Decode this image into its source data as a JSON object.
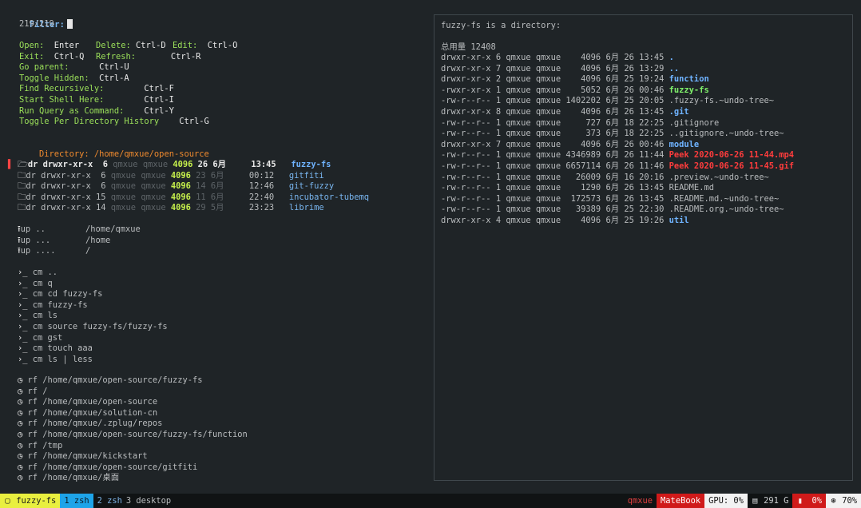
{
  "filter": {
    "label": "Filter:",
    "count": "219/219"
  },
  "help": [
    [
      {
        "k": "Open:",
        "v": "  Enter"
      },
      {
        "k": "Delete:",
        "v": " Ctrl-D"
      },
      {
        "k": "Edit:",
        "v": "  Ctrl-O"
      }
    ],
    [
      {
        "k": "Exit:",
        "v": "  Ctrl-Q"
      },
      {
        "k": "Refresh:",
        "v": "       Ctrl-R"
      }
    ],
    [
      {
        "k": "Go parent:",
        "v": "      Ctrl-U"
      }
    ],
    [
      {
        "k": "Toggle Hidden:",
        "v": "  Ctrl-A"
      }
    ],
    [
      {
        "k": "Find Recursively:",
        "v": "        Ctrl-F"
      }
    ],
    [
      {
        "k": "Start Shell Here:",
        "v": "        Ctrl-I"
      }
    ],
    [
      {
        "k": "Run Query as Command:",
        "v": "    Ctrl-Y"
      }
    ],
    [
      {
        "k": "Toggle Per Directory History",
        "v": "    Ctrl-G"
      }
    ]
  ],
  "directory": {
    "label": "Directory:",
    "path": "/home/qmxue/open-source"
  },
  "entries": [
    {
      "mode": "dr drwxr-xr-x",
      "links": "6",
      "user": "qmxue",
      "group": "qmxue",
      "size": "4096",
      "date": "26 6月",
      "time": "13:45",
      "name": "fuzzy-fs",
      "selected": true
    },
    {
      "mode": "dr drwxr-xr-x",
      "links": "6",
      "user": "qmxue",
      "group": "qmxue",
      "size": "4096",
      "date": "23 6月",
      "time": "00:12",
      "name": "gitfiti",
      "selected": false
    },
    {
      "mode": "dr drwxr-xr-x",
      "links": "6",
      "user": "qmxue",
      "group": "qmxue",
      "size": "4096",
      "date": "14 6月",
      "time": "12:46",
      "name": "git-fuzzy",
      "selected": false
    },
    {
      "mode": "dr drwxr-xr-x",
      "links": "15",
      "user": "qmxue",
      "group": "qmxue",
      "size": "4096",
      "date": "11 6月",
      "time": "22:40",
      "name": "incubator-tubemq",
      "selected": false
    },
    {
      "mode": "dr drwxr-xr-x",
      "links": "14",
      "user": "qmxue",
      "group": "qmxue",
      "size": "4096",
      "date": "29 5月",
      "time": "23:23",
      "name": "librime",
      "selected": false
    }
  ],
  "ups": [
    {
      "cmd": "up",
      "arg": "..",
      "path": "/home/qmxue"
    },
    {
      "cmd": "up",
      "arg": "...",
      "path": "/home"
    },
    {
      "cmd": "up",
      "arg": "....",
      "path": "/"
    }
  ],
  "cmds": [
    {
      "cmd": "cm",
      "arg": ".."
    },
    {
      "cmd": "cm",
      "arg": "q"
    },
    {
      "cmd": "cm",
      "arg": "cd fuzzy-fs"
    },
    {
      "cmd": "cm",
      "arg": "fuzzy-fs"
    },
    {
      "cmd": "cm",
      "arg": "ls"
    },
    {
      "cmd": "cm",
      "arg": "source fuzzy-fs/fuzzy-fs"
    },
    {
      "cmd": "cm",
      "arg": "gst"
    },
    {
      "cmd": "cm",
      "arg": "touch aaa"
    },
    {
      "cmd": "cm",
      "arg": "ls | less"
    }
  ],
  "recents": [
    {
      "cmd": "rf",
      "arg": "/home/qmxue/open-source/fuzzy-fs"
    },
    {
      "cmd": "rf",
      "arg": "/"
    },
    {
      "cmd": "rf",
      "arg": "/home/qmxue/open-source"
    },
    {
      "cmd": "rf",
      "arg": "/home/qmxue/solution-cn"
    },
    {
      "cmd": "rf",
      "arg": "/home/qmxue/.zplug/repos"
    },
    {
      "cmd": "rf",
      "arg": "/home/qmxue/open-source/fuzzy-fs/function"
    },
    {
      "cmd": "rf",
      "arg": "/tmp"
    },
    {
      "cmd": "rf",
      "arg": "/home/qmxue/kickstart"
    },
    {
      "cmd": "rf",
      "arg": "/home/qmxue/open-source/gitfiti"
    },
    {
      "cmd": "rf",
      "arg": "/home/qmxue/桌面"
    }
  ],
  "preview": {
    "header": "fuzzy-fs is a directory:",
    "total": "总用量 12408",
    "rows": [
      {
        "perm": "drwxr-xr-x",
        "n": "6",
        "u": "qmxue",
        "g": "qmxue",
        "size": "4096",
        "m": "6月",
        "d": "26",
        "t": "13:45",
        "name": ".",
        "style": "blue"
      },
      {
        "perm": "drwxr-xr-x",
        "n": "7",
        "u": "qmxue",
        "g": "qmxue",
        "size": "4096",
        "m": "6月",
        "d": "26",
        "t": "13:29",
        "name": "..",
        "style": "blue"
      },
      {
        "perm": "drwxr-xr-x",
        "n": "2",
        "u": "qmxue",
        "g": "qmxue",
        "size": "4096",
        "m": "6月",
        "d": "25",
        "t": "19:24",
        "name": "function",
        "style": "blue"
      },
      {
        "perm": "-rwxr-xr-x",
        "n": "1",
        "u": "qmxue",
        "g": "qmxue",
        "size": "5052",
        "m": "6月",
        "d": "26",
        "t": "00:46",
        "name": "fuzzy-fs",
        "style": "green"
      },
      {
        "perm": "-rw-r--r--",
        "n": "1",
        "u": "qmxue",
        "g": "qmxue",
        "size": "1402202",
        "m": "6月",
        "d": "25",
        "t": "20:05",
        "name": ".fuzzy-fs.~undo-tree~",
        "style": "plain"
      },
      {
        "perm": "drwxr-xr-x",
        "n": "8",
        "u": "qmxue",
        "g": "qmxue",
        "size": "4096",
        "m": "6月",
        "d": "26",
        "t": "13:45",
        "name": ".git",
        "style": "blue"
      },
      {
        "perm": "-rw-r--r--",
        "n": "1",
        "u": "qmxue",
        "g": "qmxue",
        "size": "727",
        "m": "6月",
        "d": "18",
        "t": "22:25",
        "name": ".gitignore",
        "style": "plain"
      },
      {
        "perm": "-rw-r--r--",
        "n": "1",
        "u": "qmxue",
        "g": "qmxue",
        "size": "373",
        "m": "6月",
        "d": "18",
        "t": "22:25",
        "name": "..gitignore.~undo-tree~",
        "style": "plain"
      },
      {
        "perm": "drwxr-xr-x",
        "n": "7",
        "u": "qmxue",
        "g": "qmxue",
        "size": "4096",
        "m": "6月",
        "d": "26",
        "t": "00:46",
        "name": "module",
        "style": "blue"
      },
      {
        "perm": "-rw-r--r--",
        "n": "1",
        "u": "qmxue",
        "g": "qmxue",
        "size": "4346989",
        "m": "6月",
        "d": "26",
        "t": "11:44",
        "name": "Peek 2020-06-26 11-44.mp4",
        "style": "red"
      },
      {
        "perm": "-rw-r--r--",
        "n": "1",
        "u": "qmxue",
        "g": "qmxue",
        "size": "6657114",
        "m": "6月",
        "d": "26",
        "t": "11:46",
        "name": "Peek 2020-06-26 11-45.gif",
        "style": "red"
      },
      {
        "perm": "-rw-r--r--",
        "n": "1",
        "u": "qmxue",
        "g": "qmxue",
        "size": "26009",
        "m": "6月",
        "d": "16",
        "t": "20:16",
        "name": ".preview.~undo-tree~",
        "style": "plain"
      },
      {
        "perm": "-rw-r--r--",
        "n": "1",
        "u": "qmxue",
        "g": "qmxue",
        "size": "1290",
        "m": "6月",
        "d": "26",
        "t": "13:45",
        "name": "README.md",
        "style": "plain"
      },
      {
        "perm": "-rw-r--r--",
        "n": "1",
        "u": "qmxue",
        "g": "qmxue",
        "size": "172573",
        "m": "6月",
        "d": "26",
        "t": "13:45",
        "name": ".README.md.~undo-tree~",
        "style": "plain"
      },
      {
        "perm": "-rw-r--r--",
        "n": "1",
        "u": "qmxue",
        "g": "qmxue",
        "size": "39389",
        "m": "6月",
        "d": "25",
        "t": "22:30",
        "name": ".README.org.~undo-tree~",
        "style": "plain"
      },
      {
        "perm": "drwxr-xr-x",
        "n": "4",
        "u": "qmxue",
        "g": "qmxue",
        "size": "4096",
        "m": "6月",
        "d": "25",
        "t": "19:26",
        "name": "util",
        "style": "blue"
      }
    ]
  },
  "status": {
    "session": "fuzzy-fs",
    "win1": "1 zsh",
    "win2": "2 zsh",
    "win3": "3 desktop",
    "user": "qmxue",
    "host": "MateBook",
    "gpu": "GPU: 0%",
    "disk": "291 G",
    "bat": "0%",
    "cpu": "70%"
  },
  "colors": {
    "accent_yellow": "#e9ef3f",
    "accent_blue": "#1ea4e9",
    "host_red": "#d01a1a"
  }
}
